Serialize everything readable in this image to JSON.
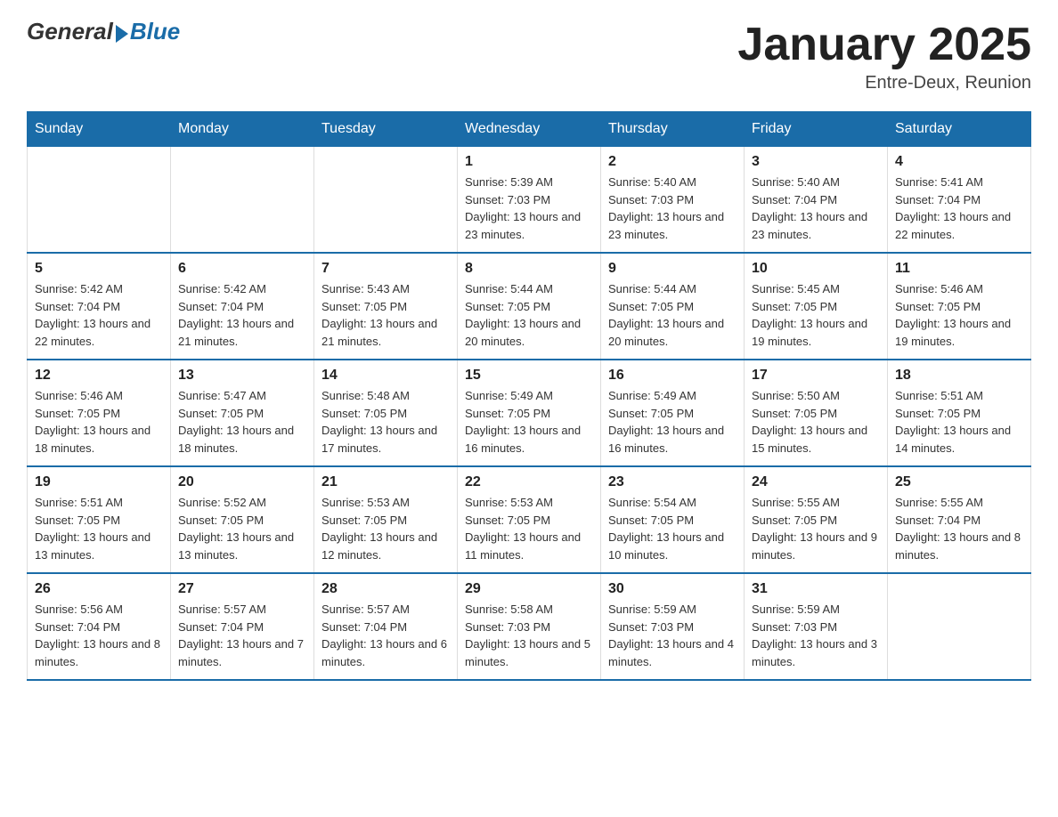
{
  "header": {
    "logo_general": "General",
    "logo_blue": "Blue",
    "title": "January 2025",
    "location": "Entre-Deux, Reunion"
  },
  "days_of_week": [
    "Sunday",
    "Monday",
    "Tuesday",
    "Wednesday",
    "Thursday",
    "Friday",
    "Saturday"
  ],
  "weeks": [
    {
      "days": [
        {
          "num": "",
          "info": ""
        },
        {
          "num": "",
          "info": ""
        },
        {
          "num": "",
          "info": ""
        },
        {
          "num": "1",
          "info": "Sunrise: 5:39 AM\nSunset: 7:03 PM\nDaylight: 13 hours and 23 minutes."
        },
        {
          "num": "2",
          "info": "Sunrise: 5:40 AM\nSunset: 7:03 PM\nDaylight: 13 hours and 23 minutes."
        },
        {
          "num": "3",
          "info": "Sunrise: 5:40 AM\nSunset: 7:04 PM\nDaylight: 13 hours and 23 minutes."
        },
        {
          "num": "4",
          "info": "Sunrise: 5:41 AM\nSunset: 7:04 PM\nDaylight: 13 hours and 22 minutes."
        }
      ]
    },
    {
      "days": [
        {
          "num": "5",
          "info": "Sunrise: 5:42 AM\nSunset: 7:04 PM\nDaylight: 13 hours and 22 minutes."
        },
        {
          "num": "6",
          "info": "Sunrise: 5:42 AM\nSunset: 7:04 PM\nDaylight: 13 hours and 21 minutes."
        },
        {
          "num": "7",
          "info": "Sunrise: 5:43 AM\nSunset: 7:05 PM\nDaylight: 13 hours and 21 minutes."
        },
        {
          "num": "8",
          "info": "Sunrise: 5:44 AM\nSunset: 7:05 PM\nDaylight: 13 hours and 20 minutes."
        },
        {
          "num": "9",
          "info": "Sunrise: 5:44 AM\nSunset: 7:05 PM\nDaylight: 13 hours and 20 minutes."
        },
        {
          "num": "10",
          "info": "Sunrise: 5:45 AM\nSunset: 7:05 PM\nDaylight: 13 hours and 19 minutes."
        },
        {
          "num": "11",
          "info": "Sunrise: 5:46 AM\nSunset: 7:05 PM\nDaylight: 13 hours and 19 minutes."
        }
      ]
    },
    {
      "days": [
        {
          "num": "12",
          "info": "Sunrise: 5:46 AM\nSunset: 7:05 PM\nDaylight: 13 hours and 18 minutes."
        },
        {
          "num": "13",
          "info": "Sunrise: 5:47 AM\nSunset: 7:05 PM\nDaylight: 13 hours and 18 minutes."
        },
        {
          "num": "14",
          "info": "Sunrise: 5:48 AM\nSunset: 7:05 PM\nDaylight: 13 hours and 17 minutes."
        },
        {
          "num": "15",
          "info": "Sunrise: 5:49 AM\nSunset: 7:05 PM\nDaylight: 13 hours and 16 minutes."
        },
        {
          "num": "16",
          "info": "Sunrise: 5:49 AM\nSunset: 7:05 PM\nDaylight: 13 hours and 16 minutes."
        },
        {
          "num": "17",
          "info": "Sunrise: 5:50 AM\nSunset: 7:05 PM\nDaylight: 13 hours and 15 minutes."
        },
        {
          "num": "18",
          "info": "Sunrise: 5:51 AM\nSunset: 7:05 PM\nDaylight: 13 hours and 14 minutes."
        }
      ]
    },
    {
      "days": [
        {
          "num": "19",
          "info": "Sunrise: 5:51 AM\nSunset: 7:05 PM\nDaylight: 13 hours and 13 minutes."
        },
        {
          "num": "20",
          "info": "Sunrise: 5:52 AM\nSunset: 7:05 PM\nDaylight: 13 hours and 13 minutes."
        },
        {
          "num": "21",
          "info": "Sunrise: 5:53 AM\nSunset: 7:05 PM\nDaylight: 13 hours and 12 minutes."
        },
        {
          "num": "22",
          "info": "Sunrise: 5:53 AM\nSunset: 7:05 PM\nDaylight: 13 hours and 11 minutes."
        },
        {
          "num": "23",
          "info": "Sunrise: 5:54 AM\nSunset: 7:05 PM\nDaylight: 13 hours and 10 minutes."
        },
        {
          "num": "24",
          "info": "Sunrise: 5:55 AM\nSunset: 7:05 PM\nDaylight: 13 hours and 9 minutes."
        },
        {
          "num": "25",
          "info": "Sunrise: 5:55 AM\nSunset: 7:04 PM\nDaylight: 13 hours and 8 minutes."
        }
      ]
    },
    {
      "days": [
        {
          "num": "26",
          "info": "Sunrise: 5:56 AM\nSunset: 7:04 PM\nDaylight: 13 hours and 8 minutes."
        },
        {
          "num": "27",
          "info": "Sunrise: 5:57 AM\nSunset: 7:04 PM\nDaylight: 13 hours and 7 minutes."
        },
        {
          "num": "28",
          "info": "Sunrise: 5:57 AM\nSunset: 7:04 PM\nDaylight: 13 hours and 6 minutes."
        },
        {
          "num": "29",
          "info": "Sunrise: 5:58 AM\nSunset: 7:03 PM\nDaylight: 13 hours and 5 minutes."
        },
        {
          "num": "30",
          "info": "Sunrise: 5:59 AM\nSunset: 7:03 PM\nDaylight: 13 hours and 4 minutes."
        },
        {
          "num": "31",
          "info": "Sunrise: 5:59 AM\nSunset: 7:03 PM\nDaylight: 13 hours and 3 minutes."
        },
        {
          "num": "",
          "info": ""
        }
      ]
    }
  ]
}
